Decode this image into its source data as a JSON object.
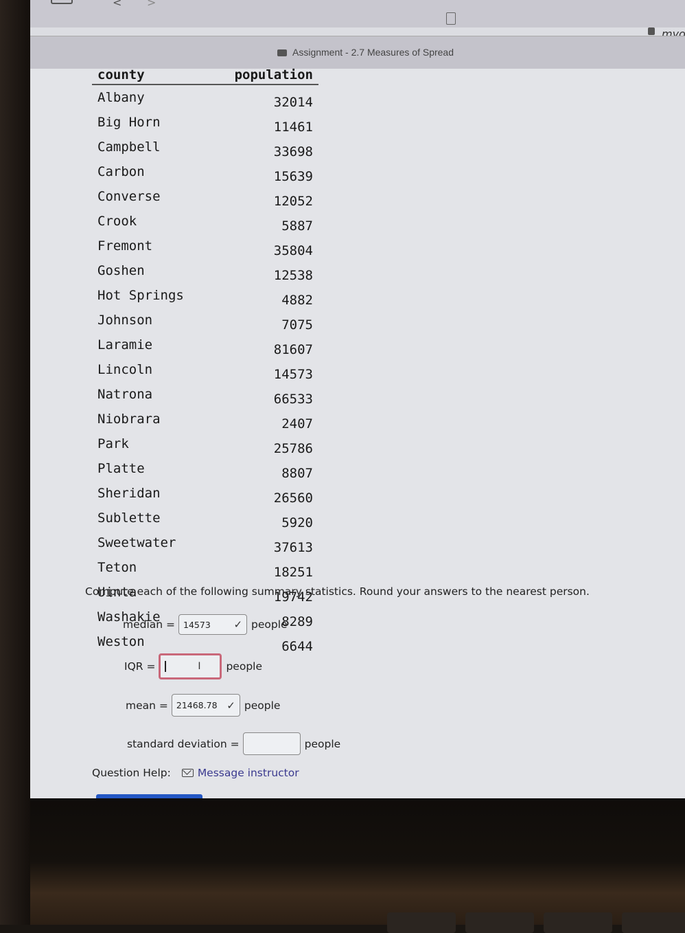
{
  "browser": {
    "url_text": "myo",
    "tab_title": "Assignment - 2.7 Measures of Spread"
  },
  "table": {
    "headers": {
      "county": "county",
      "population": "population"
    },
    "rows": [
      {
        "county": "Albany",
        "population": "32014"
      },
      {
        "county": "Big Horn",
        "population": "11461"
      },
      {
        "county": "Campbell",
        "population": "33698"
      },
      {
        "county": "Carbon",
        "population": "15639"
      },
      {
        "county": "Converse",
        "population": "12052"
      },
      {
        "county": "Crook",
        "population": "5887"
      },
      {
        "county": "Fremont",
        "population": "35804"
      },
      {
        "county": "Goshen",
        "population": "12538"
      },
      {
        "county": "Hot Springs",
        "population": "4882"
      },
      {
        "county": "Johnson",
        "population": "7075"
      },
      {
        "county": "Laramie",
        "population": "81607"
      },
      {
        "county": "Lincoln",
        "population": "14573"
      },
      {
        "county": "Natrona",
        "population": "66533"
      },
      {
        "county": "Niobrara",
        "population": "2407"
      },
      {
        "county": "Park",
        "population": "25786"
      },
      {
        "county": "Platte",
        "population": "8807"
      },
      {
        "county": "Sheridan",
        "population": "26560"
      },
      {
        "county": "Sublette",
        "population": "5920"
      },
      {
        "county": "Sweetwater",
        "population": "37613"
      },
      {
        "county": "Teton",
        "population": "18251"
      },
      {
        "county": "Uinta",
        "population": "19742"
      },
      {
        "county": "Washakie",
        "population": "8289"
      },
      {
        "county": "Weston",
        "population": "6644"
      }
    ]
  },
  "question": {
    "prompt": "Compute each of the following summary statistics. Round your answers to the nearest person.",
    "unit": "people",
    "median": {
      "label": "median =",
      "value": "14573",
      "status": "correct"
    },
    "iqr": {
      "label": "IQR =",
      "value": "",
      "status": "active"
    },
    "mean": {
      "label": "mean =",
      "value": "21468.78",
      "status": "correct"
    },
    "std": {
      "label": "standard deviation =",
      "value": "",
      "status": "empty"
    }
  },
  "help": {
    "label": "Question Help:",
    "message_link": "Message instructor"
  },
  "colors": {
    "active_border": "#c9687a",
    "link": "#3b3a8f",
    "submit_button": "#2457c4"
  }
}
